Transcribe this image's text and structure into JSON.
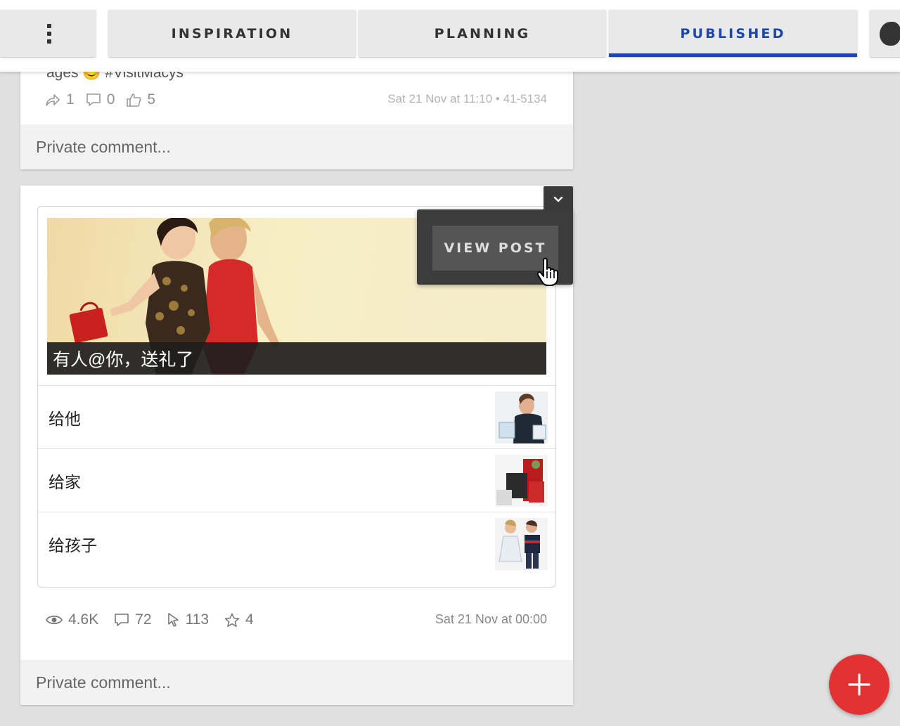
{
  "tabs": [
    {
      "label": "INSPIRATION"
    },
    {
      "label": "PLANNING"
    },
    {
      "label": "PUBLISHED",
      "active": true
    }
  ],
  "accent_color": "#1a47a8",
  "post1": {
    "text_fragment": "ages 😊 #VisitMacys",
    "shares": "1",
    "comments": "0",
    "likes": "5",
    "timestamp": "Sat 21 Nov at 11:10 • 41-5134",
    "private_comment_placeholder": "Private comment..."
  },
  "post2": {
    "banner_caption": "有人@你，送礼了",
    "items": [
      {
        "label": "给他"
      },
      {
        "label": "给家"
      },
      {
        "label": "给孩子"
      }
    ],
    "views": "4.6K",
    "comments": "72",
    "clicks": "113",
    "favorites": "4",
    "timestamp": "Sat 21 Nov at 00:00",
    "private_comment_placeholder": "Private comment..."
  },
  "popup": {
    "view_post_label": "VIEW POST"
  },
  "fab_color": "#e33232"
}
